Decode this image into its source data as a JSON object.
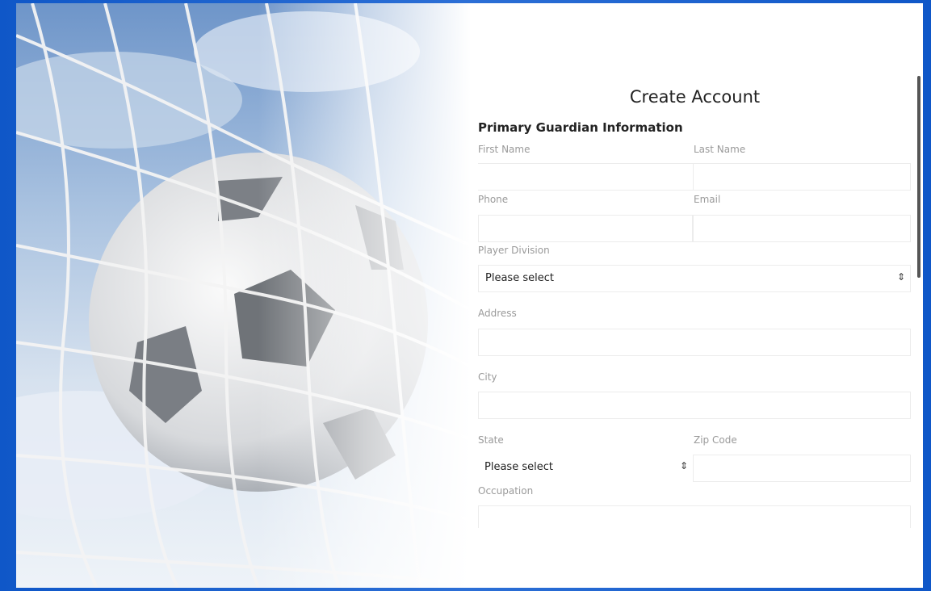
{
  "form": {
    "title": "Create Account",
    "section": "Primary Guardian Information",
    "labels": {
      "first_name": "First Name",
      "last_name": "Last Name",
      "phone": "Phone",
      "email": "Email",
      "player_division": "Player Division",
      "address": "Address",
      "city": "City",
      "state": "State",
      "zip": "Zip Code",
      "occupation": "Occupation"
    },
    "values": {
      "first_name": "",
      "last_name": "",
      "phone": "",
      "email": "",
      "address": "",
      "city": "",
      "zip": "",
      "occupation": ""
    },
    "player_division_selected": "Please select",
    "state_selected": "Please select",
    "select_arrow": "⇕"
  },
  "colors": {
    "frame_blue": "#1f63c9",
    "label_gray": "#9a9a9a",
    "border": "#ececec"
  },
  "icons": {
    "select_arrow": "sort-arrows-icon"
  }
}
